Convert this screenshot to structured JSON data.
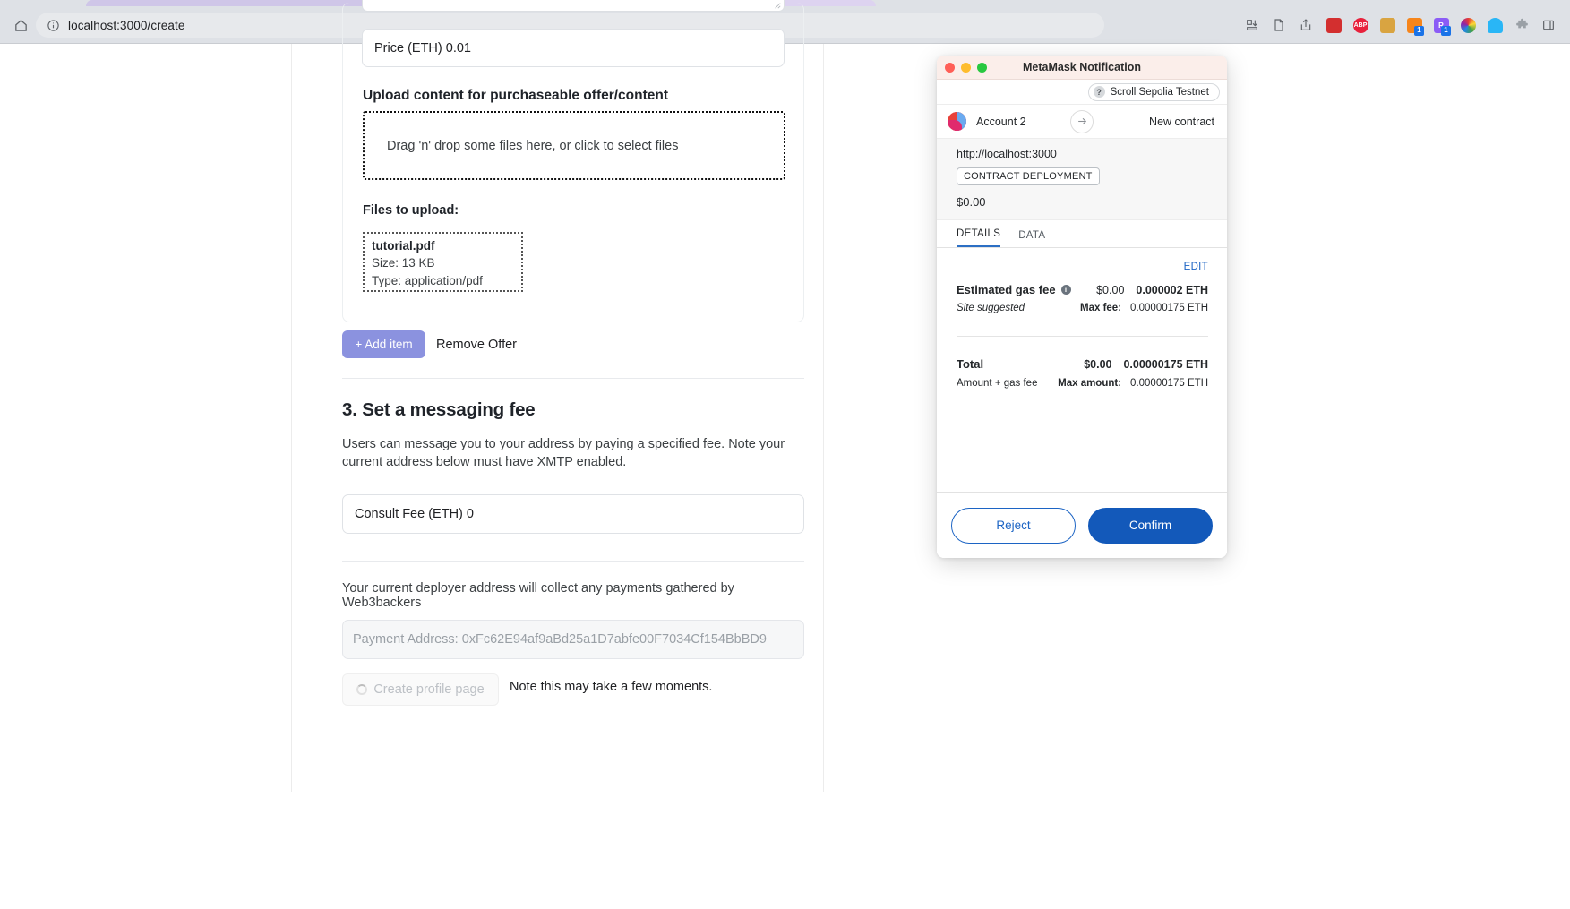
{
  "browser": {
    "home_icon": "home-icon",
    "url": "localhost:3000/create",
    "site_info_icon": "info-circle-icon",
    "toolbar_icons": [
      {
        "name": "install-app-icon"
      },
      {
        "name": "reading-list-icon"
      },
      {
        "name": "share-icon"
      },
      {
        "name": "bookmark-star-icon"
      }
    ],
    "extensions": [
      {
        "name": "extension-pocket-icon",
        "label": "",
        "color": "#d32f2f",
        "badge": ""
      },
      {
        "name": "extension-adblock-plus-icon",
        "label": "ABP",
        "color": "#e8213c",
        "badge": ""
      },
      {
        "name": "extension-notebook-icon",
        "label": "",
        "color": "#d9a441",
        "badge": ""
      },
      {
        "name": "extension-metamask-icon",
        "label": "",
        "color": "#f6851b",
        "badge": "1"
      },
      {
        "name": "extension-rabby-icon",
        "label": "R",
        "color": "#8b5cf6",
        "badge": "1"
      },
      {
        "name": "extension-color-wheel-icon",
        "label": "",
        "color": "#4caf50",
        "badge": ""
      },
      {
        "name": "extension-database-icon",
        "label": "",
        "color": "#29b6f6",
        "badge": ""
      },
      {
        "name": "extensions-puzzle-icon",
        "label": "",
        "color": "#9aa0a6",
        "badge": ""
      },
      {
        "name": "side-panel-icon",
        "label": "",
        "color": "#5f6368",
        "badge": ""
      }
    ]
  },
  "form": {
    "price_field": {
      "value": "Price (ETH) 0.01"
    },
    "upload_label": "Upload content for purchaseable offer/content",
    "dropzone_text": "Drag 'n' drop some files here, or click to select files",
    "files_to_upload_label": "Files to upload:",
    "files": [
      {
        "name": "tutorial.pdf",
        "size": "Size: 13 KB",
        "type": "Type: application/pdf"
      }
    ],
    "add_item_label": "+ Add item",
    "remove_offer_label": "Remove Offer",
    "section3": {
      "heading": "3. Set a messaging fee",
      "description": "Users can message you to your address by paying a specified fee. Note your current address below must have XMTP enabled.",
      "consult_fee_value": "Consult Fee (ETH) 0"
    },
    "deployer_note": "Your current deployer address will collect any payments gathered by Web3backers",
    "payment_address_placeholder": "Payment Address: 0xFc62E94af9aBd25a1D7abfe00F7034Cf154BbBD9",
    "create_button_label": "Create profile page",
    "create_note": "Note this may take a few moments."
  },
  "metamask": {
    "window_title": "MetaMask Notification",
    "network": {
      "icon": "question-mark-icon",
      "name": "Scroll Sepolia Testnet"
    },
    "account": {
      "name": "Account 2",
      "avatar": "account-avatar",
      "arrow_icon": "arrow-right-icon",
      "target": "New contract"
    },
    "origin": "http://localhost:3000",
    "deployment_badge": "CONTRACT DEPLOYMENT",
    "amount": "$0.00",
    "tabs": [
      {
        "label": "DETAILS",
        "active": true
      },
      {
        "label": "DATA",
        "active": false
      }
    ],
    "edit_label": "EDIT",
    "gas": {
      "label": "Estimated gas fee",
      "info_icon": "info-icon",
      "usd": "$0.00",
      "eth": "0.000002 ETH",
      "sub_label": "Site suggested",
      "max_label": "Max fee:",
      "max_value": "0.00000175 ETH"
    },
    "total": {
      "label": "Total",
      "usd": "$0.00",
      "eth": "0.00000175 ETH",
      "sub_label": "Amount + gas fee",
      "max_label": "Max amount:",
      "max_value": "0.00000175 ETH"
    },
    "reject_label": "Reject",
    "confirm_label": "Confirm",
    "colors": {
      "primary": "#1359ba",
      "link": "#1c64c4",
      "titlebar": "#fbeeea"
    }
  }
}
